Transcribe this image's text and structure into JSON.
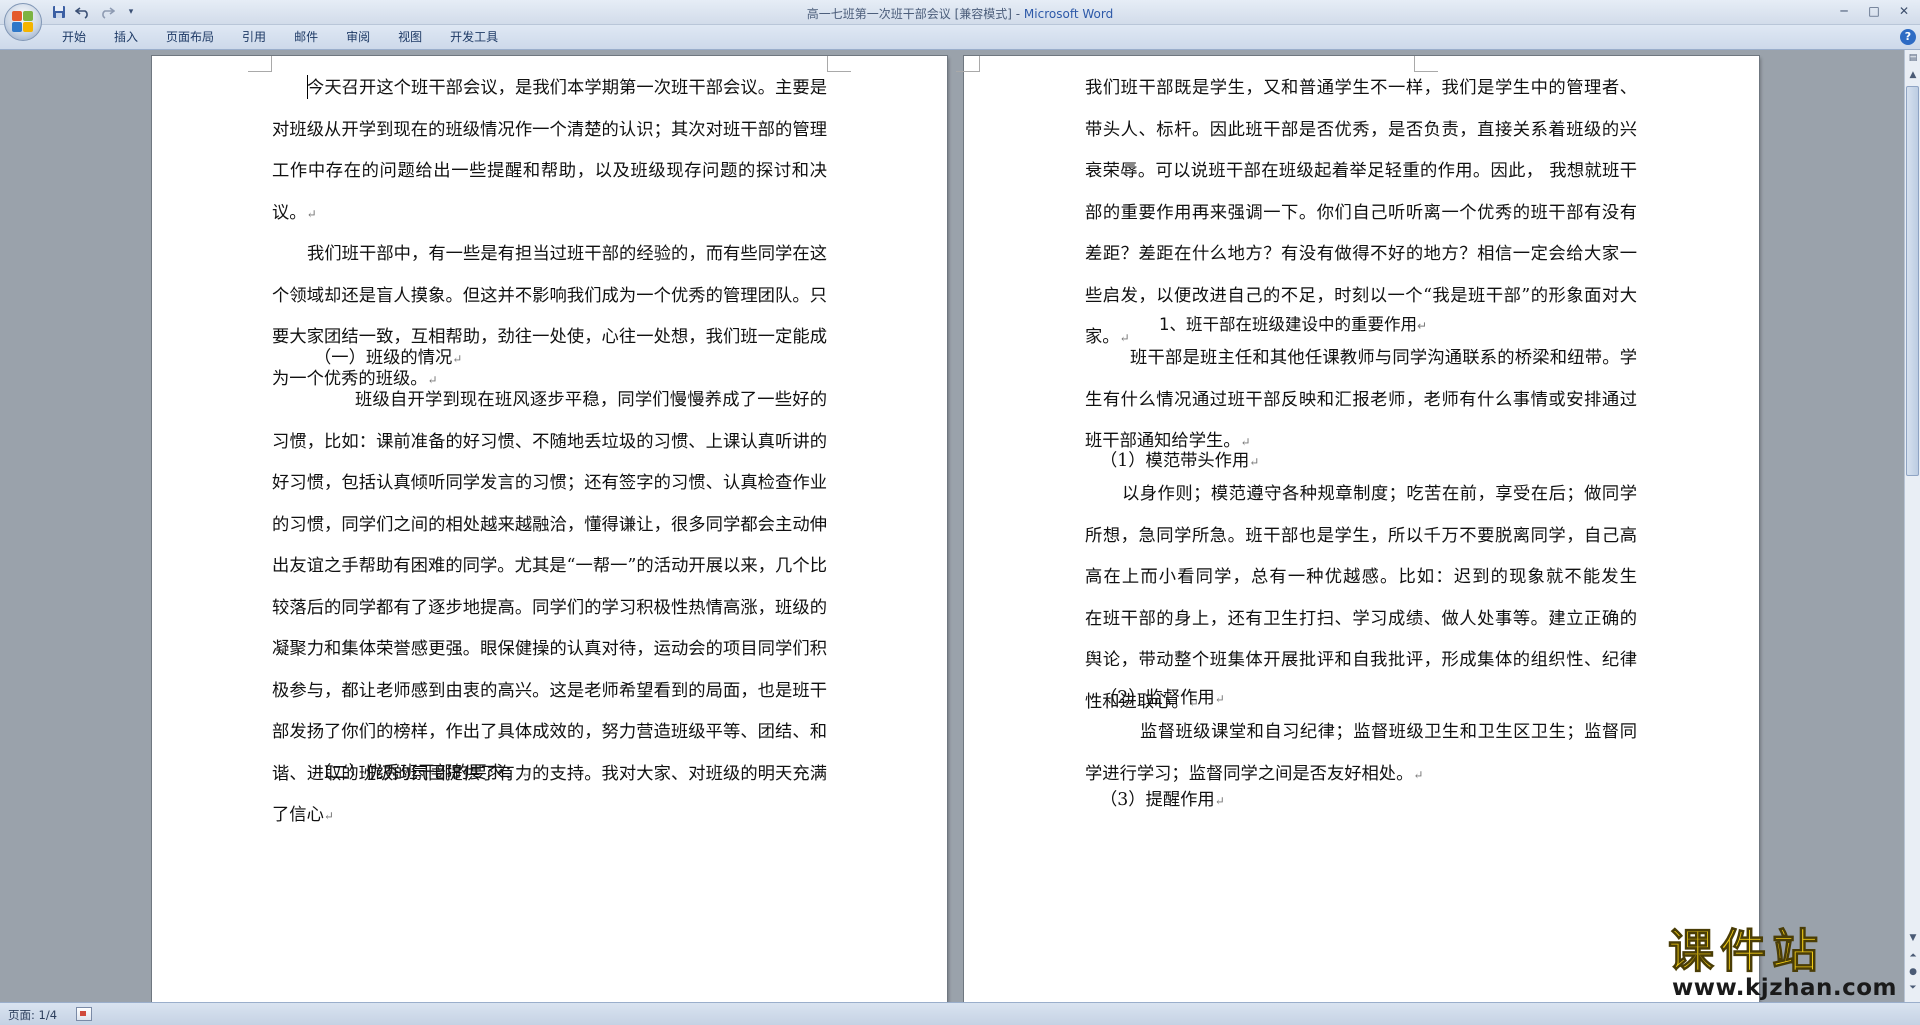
{
  "window": {
    "title_doc": "高一七班第一次班干部会议 [兼容模式] - ",
    "title_app": "Microsoft Word",
    "controls": [
      "─",
      "□",
      "✕"
    ]
  },
  "quick_access": {
    "save_icon": "save-icon",
    "undo_icon": "undo-icon",
    "redo_icon": "redo-icon",
    "customize": "▾"
  },
  "ribbon": {
    "tabs": [
      "开始",
      "插入",
      "页面布局",
      "引用",
      "邮件",
      "审阅",
      "视图",
      "开发工具"
    ],
    "help": "?"
  },
  "pages": {
    "left": {
      "p1": "今天召开这个班干部会议，是我们本学期第一次班干部会议。主要是对班级从开学到现在的班级情况作一个清楚的认识；其次对班干部的管理工作中存在的问题给出一些提醒和帮助，以及班级现存问题的探讨和决议。",
      "p2": "我们班干部中，有一些是有担当过班干部的经验的，而有些同学在这个领域却还是盲人摸象。但这并不影响我们成为一个优秀的管理团队。只要大家团结一致，互相帮助，劲往一处使，心往一处想，我们班一定能成为一个优秀的班级。",
      "h1": "（一）班级的情况",
      "p3": "班级自开学到现在班风逐步平稳，同学们慢慢养成了一些好的习惯，比如：课前准备的好习惯、不随地丢垃圾的习惯、上课认真听讲的好习惯，包括认真倾听同学发言的习惯；还有签字的习惯、认真检查作业的习惯，同学们之间的相处越来越融洽，懂得谦让，很多同学都会主动伸出友谊之手帮助有困难的同学。尤其是“一帮一”的活动开展以来，几个比较落后的同学都有了逐步地提高。同学们的学习积极性热情高涨，班级的凝聚力和集体荣誉感更强。眼保健操的认真对待，运动会的项目同学们积极参与，都让老师感到由衷的高兴。这是老师希望看到的局面，也是班干部发扬了你们的榜样，作出了具体成效的，努力营造班级平等、团结、和谐、进取的班级的氛围提供了有力的支持。我对大家、对班级的明天充满了信心",
      "h2": "（二）优秀班干部的要求："
    },
    "right": {
      "p1": "我们班干部既是学生，又和普通学生不一样，我们是学生中的管理者、带头人、标杆。因此班干部是否优秀，是否负责，直接关系着班级的兴衰荣辱。可以说班干部在班级起着举足轻重的作用。因此， 我想就班干部的重要作用再来强调一下。你们自己听听离一个优秀的班干部有没有差距？差距在什么地方？有没有做得不好的地方？相信一定会给大家一些启发，以便改进自己的不足，时刻以一个“我是班干部”的形象面对大家。",
      "h1": "1、班干部在班级建设中的重要作用",
      "p2": "班干部是班主任和其他任课教师与同学沟通联系的桥梁和纽带。学生有什么情况通过班干部反映和汇报老师，老师有什么事情或安排通过班干部通知给学生。",
      "h2": "（1）模范带头作用",
      "p3": "以身作则；模范遵守各种规章制度；吃苦在前，享受在后；做同学所想，急同学所急。班干部也是学生，所以千万不要脱离同学，自己高高在上而小看同学，总有一种优越感。比如：迟到的现象就不能发生　在班干部的身上，还有卫生打扫、学习成绩、做人处事等。建立正确的舆论，带动整个班集体开展批评和自我批评，形成集体的组织性、纪律性和进取心。",
      "h3": "（2）监督作用",
      "p4": "监督班级课堂和自习纪律；监督班级卫生和卫生区卫生；监督同学进行学习；监督同学之间是否友好相处。",
      "h4": "（3）提醒作用"
    },
    "paragraph_mark": "↵"
  },
  "statusbar": {
    "page": "页面: 1/4"
  },
  "watermark": {
    "title": "课件站",
    "url": "www.kjzhan.com"
  },
  "colors": {
    "watermark_yellow": "#f2cc16",
    "title_app_blue": "#2d59a8"
  }
}
